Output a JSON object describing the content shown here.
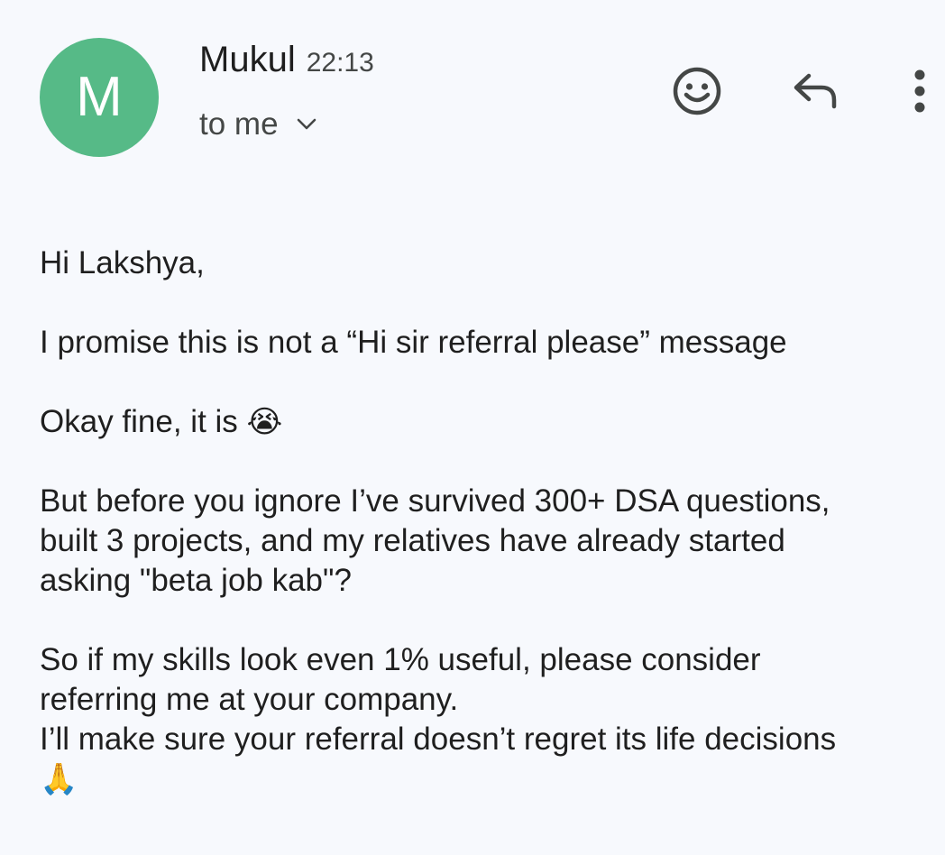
{
  "sender": {
    "avatar_letter": "M",
    "avatar_color": "#56ba87",
    "name": "Mukul",
    "time": "22:13",
    "recipient": "to me"
  },
  "actions": {
    "emoji_icon": "add-reaction-icon",
    "reply_icon": "reply-icon",
    "more_icon": "more-vertical-icon"
  },
  "message": {
    "greeting": "Hi Lakshya,",
    "line1": "I promise this is not a “Hi sir referral please” message",
    "line2_text": "Okay fine, it is ",
    "line2_emoji": "😭",
    "para3_line1": "But before you ignore I’ve survived 300+ DSA questions,",
    "para3_line2": "built 3 projects, and my relatives have already started",
    "para3_line3": "asking \"beta job kab\"?",
    "para4_line1": "So if my skills look even 1% useful, please consider",
    "para4_line2": "referring me at your company.",
    "para4_line3": "I’ll make sure your referral doesn’t regret its life decisions",
    "closing_emoji": "🙏"
  }
}
